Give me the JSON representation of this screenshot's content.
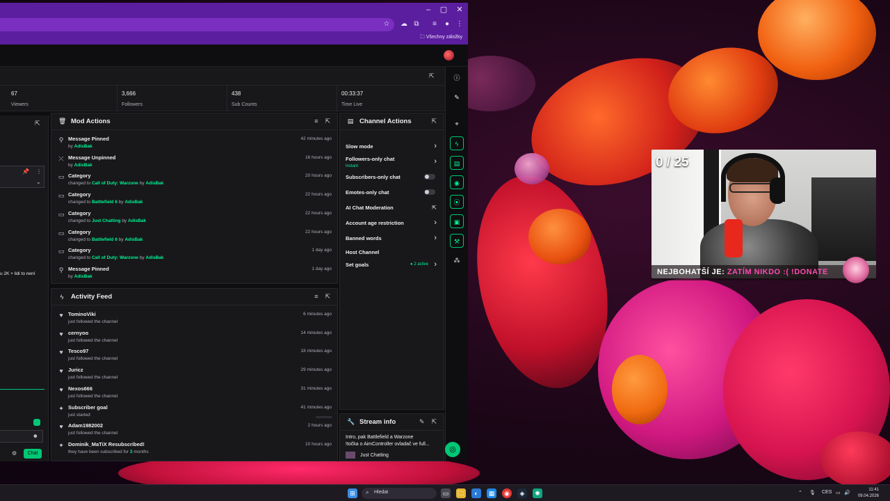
{
  "browser": {
    "bookmark_label": "Všechny záložky",
    "window_controls": {
      "minimize": "–",
      "maximize": "▢",
      "close": "✕"
    }
  },
  "stats": [
    {
      "value": "67",
      "label": "Viewers"
    },
    {
      "value": "3,666",
      "label": "Followers"
    },
    {
      "value": "438",
      "label": "Sub Counts"
    },
    {
      "value": "00:33:37",
      "label": "Time Live"
    }
  ],
  "left_panel": {
    "fragment_text": "u 2K + lidi to není",
    "chat_button": "Chat"
  },
  "mod_actions": {
    "title": "Mod Actions",
    "items": [
      {
        "icon": "pin-icon",
        "action": "Message Pinned",
        "detail_prefix": "by ",
        "detail_user": "AdisBak",
        "detail_suffix": "",
        "time": "42 minutes ago"
      },
      {
        "icon": "unpin-icon",
        "action": "Message Unpinned",
        "detail_prefix": "by ",
        "detail_user": "AdisBak",
        "detail_suffix": "",
        "time": "16 hours ago"
      },
      {
        "icon": "category-icon",
        "action": "Category",
        "detail_prefix": "changed to ",
        "detail_user": "Call of Duty: Warzone",
        "detail_suffix": " by ",
        "detail_user2": "AdisBak",
        "time": "20 hours ago"
      },
      {
        "icon": "category-icon",
        "action": "Category",
        "detail_prefix": "changed to ",
        "detail_user": "Battlefield 6",
        "detail_suffix": " by ",
        "detail_user2": "AdisBak",
        "time": "22 hours ago"
      },
      {
        "icon": "category-icon",
        "action": "Category",
        "detail_prefix": "changed to ",
        "detail_user": "Just Chatting",
        "detail_suffix": " by ",
        "detail_user2": "AdisBak",
        "time": "22 hours ago"
      },
      {
        "icon": "category-icon",
        "action": "Category",
        "detail_prefix": "changed to ",
        "detail_user": "Battlefield 6",
        "detail_suffix": " by ",
        "detail_user2": "AdisBak",
        "time": "22 hours ago"
      },
      {
        "icon": "category-icon",
        "action": "Category",
        "detail_prefix": "changed to ",
        "detail_user": "Call of Duty: Warzone",
        "detail_suffix": " by ",
        "detail_user2": "AdisBak",
        "time": "1 day ago"
      },
      {
        "icon": "pin-icon",
        "action": "Message Pinned",
        "detail_prefix": "by ",
        "detail_user": "AdisBak",
        "detail_suffix": "",
        "time": "1 day ago"
      }
    ]
  },
  "activity_feed": {
    "title": "Activity Feed",
    "items": [
      {
        "icon": "heart-icon",
        "name": "TominoViki",
        "detail": "just followed the channel",
        "time": "6 minutes ago"
      },
      {
        "icon": "heart-icon",
        "name": "cernyoo",
        "detail": "just followed the channel",
        "time": "14 minutes ago"
      },
      {
        "icon": "heart-icon",
        "name": "Tesco97",
        "detail": "just followed the channel",
        "time": "18 minutes ago"
      },
      {
        "icon": "heart-icon",
        "name": "Juricz",
        "detail": "just followed the channel",
        "time": "29 minutes ago"
      },
      {
        "icon": "heart-icon",
        "name": "Nexos666",
        "detail": "just followed the channel",
        "time": "31 minutes ago"
      },
      {
        "icon": "sparkle-icon",
        "name": "Subscriber goal",
        "detail": "just started",
        "time": "41 minutes ago"
      },
      {
        "icon": "heart-icon",
        "name": "Adam1982002",
        "detail": "just followed the channel",
        "time": "2 hours ago"
      },
      {
        "icon": "sparkle-icon",
        "name": "Dominik_MaTiX Resubscribed!",
        "detail": "they have been subscribed for ",
        "detail_highlight": "3",
        "detail_suffix": " months",
        "time": "10 hours ago"
      }
    ]
  },
  "channel_actions": {
    "title": "Channel Actions",
    "items": [
      {
        "label": "Slow mode",
        "type": "chevron"
      },
      {
        "label": "Followers-only chat",
        "sub": "Instant",
        "type": "chevron"
      },
      {
        "label": "Subscribers-only chat",
        "type": "toggle",
        "on": false
      },
      {
        "label": "Emotes-only chat",
        "type": "toggle",
        "on": false
      },
      {
        "label": "AI Chat Moderation",
        "type": "external"
      },
      {
        "label": "Account age restriction",
        "type": "chevron"
      },
      {
        "label": "Banned words",
        "type": "chevron"
      },
      {
        "label": "Host Channel",
        "type": "none"
      },
      {
        "label": "Set goals",
        "badge": "2 active",
        "type": "chevron"
      }
    ]
  },
  "stream_info": {
    "title": "Stream info",
    "stream_title": "Intro, pak Battlefield a Warzone",
    "stream_title_line2": "!točka o AimController ovladač ve full...",
    "category": "Just Chatting"
  },
  "overlay": {
    "counter": "0 / 25",
    "ticker_label": "NEJBOHATŠÍ JE:",
    "ticker_value": " ZATÍM NIKDO :( !DONATE"
  },
  "taskbar": {
    "search_placeholder": "Hledat",
    "lang": "CES",
    "time": "11:41",
    "date": "09.04.2026"
  },
  "colors": {
    "accent_green": "#00f593",
    "browser_purple": "#5b1e9e",
    "panel_bg": "#18181b"
  }
}
